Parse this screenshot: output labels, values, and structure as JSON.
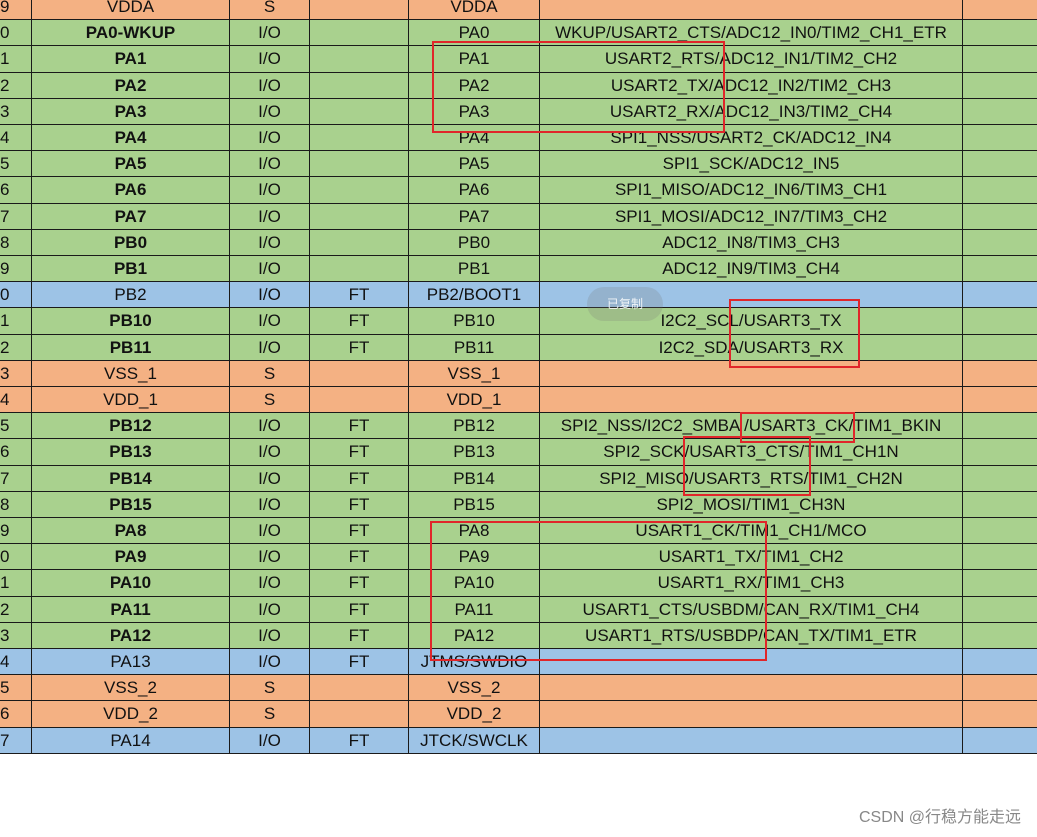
{
  "colors": {
    "orange": "#f4b183",
    "green": "#a9d18e",
    "blue": "#9dc3e6",
    "highlight_box": "#e0262a"
  },
  "rows": [
    {
      "num": "9",
      "name": "VDDA",
      "bold": false,
      "type": "S",
      "ft": "",
      "main": "VDDA",
      "alt": "",
      "color": "orange"
    },
    {
      "num": "0",
      "name": "PA0-WKUP",
      "bold": true,
      "type": "I/O",
      "ft": "",
      "main": "PA0",
      "alt": "WKUP/USART2_CTS/ADC12_IN0/TIM2_CH1_ETR",
      "color": "green"
    },
    {
      "num": "1",
      "name": "PA1",
      "bold": true,
      "type": "I/O",
      "ft": "",
      "main": "PA1",
      "alt": "USART2_RTS/ADC12_IN1/TIM2_CH2",
      "color": "green"
    },
    {
      "num": "2",
      "name": "PA2",
      "bold": true,
      "type": "I/O",
      "ft": "",
      "main": "PA2",
      "alt": "USART2_TX/ADC12_IN2/TIM2_CH3",
      "color": "green"
    },
    {
      "num": "3",
      "name": "PA3",
      "bold": true,
      "type": "I/O",
      "ft": "",
      "main": "PA3",
      "alt": "USART2_RX/ADC12_IN3/TIM2_CH4",
      "color": "green"
    },
    {
      "num": "4",
      "name": "PA4",
      "bold": true,
      "type": "I/O",
      "ft": "",
      "main": "PA4",
      "alt": "SPI1_NSS/USART2_CK/ADC12_IN4",
      "color": "green"
    },
    {
      "num": "5",
      "name": "PA5",
      "bold": true,
      "type": "I/O",
      "ft": "",
      "main": "PA5",
      "alt": "SPI1_SCK/ADC12_IN5",
      "color": "green"
    },
    {
      "num": "6",
      "name": "PA6",
      "bold": true,
      "type": "I/O",
      "ft": "",
      "main": "PA6",
      "alt": "SPI1_MISO/ADC12_IN6/TIM3_CH1",
      "color": "green"
    },
    {
      "num": "7",
      "name": "PA7",
      "bold": true,
      "type": "I/O",
      "ft": "",
      "main": "PA7",
      "alt": "SPI1_MOSI/ADC12_IN7/TIM3_CH2",
      "color": "green"
    },
    {
      "num": "8",
      "name": "PB0",
      "bold": true,
      "type": "I/O",
      "ft": "",
      "main": "PB0",
      "alt": "ADC12_IN8/TIM3_CH3",
      "color": "green"
    },
    {
      "num": "9",
      "name": "PB1",
      "bold": true,
      "type": "I/O",
      "ft": "",
      "main": "PB1",
      "alt": "ADC12_IN9/TIM3_CH4",
      "color": "green"
    },
    {
      "num": "0",
      "name": "PB2",
      "bold": false,
      "type": "I/O",
      "ft": "FT",
      "main": "PB2/BOOT1",
      "alt": "",
      "color": "blue"
    },
    {
      "num": "1",
      "name": "PB10",
      "bold": true,
      "type": "I/O",
      "ft": "FT",
      "main": "PB10",
      "alt": "I2C2_SCL/USART3_TX",
      "color": "green"
    },
    {
      "num": "2",
      "name": "PB11",
      "bold": true,
      "type": "I/O",
      "ft": "FT",
      "main": "PB11",
      "alt": "I2C2_SDA/USART3_RX",
      "color": "green"
    },
    {
      "num": "3",
      "name": "VSS_1",
      "bold": false,
      "type": "S",
      "ft": "",
      "main": "VSS_1",
      "alt": "",
      "color": "orange"
    },
    {
      "num": "4",
      "name": "VDD_1",
      "bold": false,
      "type": "S",
      "ft": "",
      "main": "VDD_1",
      "alt": "",
      "color": "orange"
    },
    {
      "num": "5",
      "name": "PB12",
      "bold": true,
      "type": "I/O",
      "ft": "FT",
      "main": "PB12",
      "alt": "SPI2_NSS/I2C2_SMBA /USART3_CK/TIM1_BKIN",
      "color": "green"
    },
    {
      "num": "6",
      "name": "PB13",
      "bold": true,
      "type": "I/O",
      "ft": "FT",
      "main": "PB13",
      "alt": "SPI2_SCK/USART3_CTS/TIM1_CH1N",
      "color": "green"
    },
    {
      "num": "7",
      "name": "PB14",
      "bold": true,
      "type": "I/O",
      "ft": "FT",
      "main": "PB14",
      "alt": "SPI2_MISO/USART3_RTS/TIM1_CH2N",
      "color": "green"
    },
    {
      "num": "8",
      "name": "PB15",
      "bold": true,
      "type": "I/O",
      "ft": "FT",
      "main": "PB15",
      "alt": "SPI2_MOSI/TIM1_CH3N",
      "color": "green"
    },
    {
      "num": "9",
      "name": "PA8",
      "bold": true,
      "type": "I/O",
      "ft": "FT",
      "main": "PA8",
      "alt": "USART1_CK/TIM1_CH1/MCO",
      "color": "green"
    },
    {
      "num": "0",
      "name": "PA9",
      "bold": true,
      "type": "I/O",
      "ft": "FT",
      "main": "PA9",
      "alt": "USART1_TX/TIM1_CH2",
      "color": "green"
    },
    {
      "num": "1",
      "name": "PA10",
      "bold": true,
      "type": "I/O",
      "ft": "FT",
      "main": "PA10",
      "alt": "USART1_RX/TIM1_CH3",
      "color": "green"
    },
    {
      "num": "2",
      "name": "PA11",
      "bold": true,
      "type": "I/O",
      "ft": "FT",
      "main": "PA11",
      "alt": "USART1_CTS/USBDM/CAN_RX/TIM1_CH4",
      "color": "green"
    },
    {
      "num": "3",
      "name": "PA12",
      "bold": true,
      "type": "I/O",
      "ft": "FT",
      "main": "PA12",
      "alt": "USART1_RTS/USBDP/CAN_TX/TIM1_ETR",
      "color": "green"
    },
    {
      "num": "4",
      "name": "PA13",
      "bold": false,
      "type": "I/O",
      "ft": "FT",
      "main": "JTMS/SWDIO",
      "alt": "",
      "color": "blue"
    },
    {
      "num": "5",
      "name": "VSS_2",
      "bold": false,
      "type": "S",
      "ft": "",
      "main": "VSS_2",
      "alt": "",
      "color": "orange"
    },
    {
      "num": "6",
      "name": "VDD_2",
      "bold": false,
      "type": "S",
      "ft": "",
      "main": "VDD_2",
      "alt": "",
      "color": "orange"
    },
    {
      "num": "7",
      "name": "PA14",
      "bold": false,
      "type": "I/O",
      "ft": "FT",
      "main": "JTCK/SWCLK",
      "alt": "",
      "color": "blue"
    }
  ],
  "toast": {
    "label": "已复制"
  },
  "watermark": {
    "text": "CSDN @行稳方能走远"
  }
}
